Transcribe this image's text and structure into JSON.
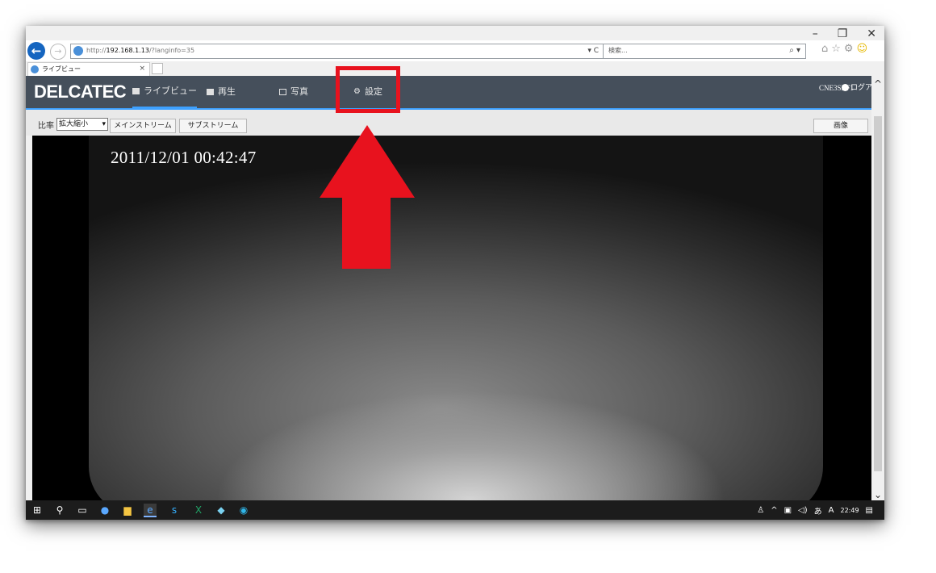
{
  "browser": {
    "url_prefix": "http://",
    "url_host": "192.168.1.13",
    "url_rest": "/?langinfo=35",
    "addr_controls": "▾ C",
    "search_placeholder": "検索...",
    "search_controls": "⌕ ▾",
    "tab_title": "ライブビュー",
    "tab_close": "×",
    "win_min": "–",
    "win_restore": "❐",
    "win_close": "✕"
  },
  "app": {
    "logo": "DELCATEC",
    "nav": [
      {
        "label": "ライブビュー"
      },
      {
        "label": "再生"
      },
      {
        "label": "写真"
      },
      {
        "label": "設定"
      }
    ],
    "device_id": "CNE3SBF1",
    "logout": "ログアウ"
  },
  "toolbar": {
    "ratio_label": "比率",
    "ratio_value": "拡大縮小",
    "main_stream": "メインストリーム",
    "sub_stream": "サブストリーム",
    "image_button": "画像"
  },
  "video": {
    "timestamp": "2011/12/01 00:42:47"
  },
  "taskbar": {
    "clock": "22:49",
    "ime": "A"
  },
  "annotation": {
    "highlight_color": "#e8121e"
  }
}
